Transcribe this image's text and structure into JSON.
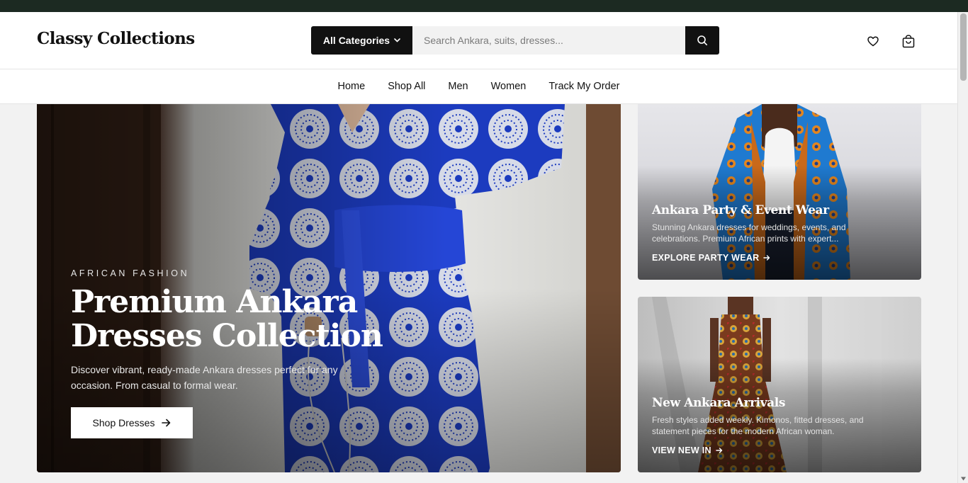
{
  "header": {
    "logo": "Classy Collections",
    "category_button": "All Categories",
    "search_placeholder": "Search Ankara, suits, dresses...",
    "icons": [
      "search-icon",
      "heart-icon",
      "cart-icon"
    ]
  },
  "nav": {
    "items": [
      "Home",
      "Shop All",
      "Men",
      "Women",
      "Track My Order"
    ]
  },
  "hero": {
    "eyebrow": "AFRICAN FASHION",
    "title": "Premium Ankara Dresses Collection",
    "description": "Discover vibrant, ready-made Ankara dresses perfect for any occasion. From casual to formal wear.",
    "button": "Shop Dresses"
  },
  "cards": [
    {
      "title": "Ankara Party & Event Wear",
      "description": "Stunning Ankara dresses for weddings, events, and celebrations. Premium African prints with expert...",
      "link": "EXPLORE PARTY WEAR"
    },
    {
      "title": "New Ankara Arrivals",
      "description": "Fresh styles added weekly. Kimonos, fitted dresses, and statement pieces for the modern African woman.",
      "link": "VIEW NEW IN"
    }
  ],
  "colors": {
    "topbar": "#1c2a22",
    "accent_dark": "#111111",
    "hero_blue": "#1f3fc4"
  }
}
